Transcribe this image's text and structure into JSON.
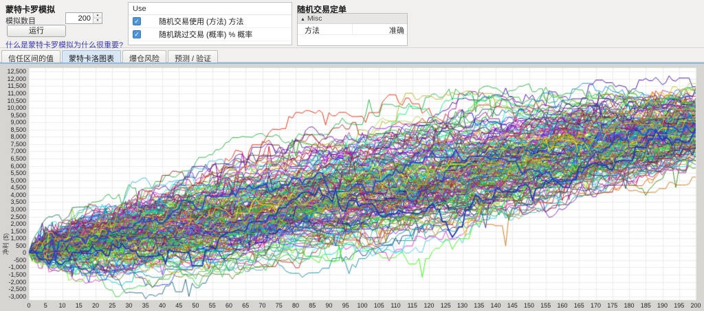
{
  "header": {
    "title": "蒙特卡罗模拟",
    "sim_count_label": "模拟数目",
    "sim_count_value": "200",
    "run_button": "运行",
    "help_link": "什么是蒙特卡罗模拟为什么很重要?"
  },
  "use_panel": {
    "header": "Use",
    "options": [
      {
        "label": "随机交易使用 (方法) 方法",
        "checked": true
      },
      {
        "label": "随机跳过交易 (概率) % 概率",
        "checked": true
      }
    ]
  },
  "orders_panel": {
    "title": "随机交易定单",
    "group": "Misc",
    "rows": [
      {
        "name": "方法",
        "value": "准确"
      }
    ]
  },
  "tabs": [
    {
      "label": "信任区间的值",
      "active": false
    },
    {
      "label": "蒙特卡洛图表",
      "active": true
    },
    {
      "label": "爆仓风险",
      "active": false
    },
    {
      "label": "预测 / 验证",
      "active": false
    }
  ],
  "chart_data": {
    "type": "line",
    "title": "",
    "xlabel": "",
    "ylabel": "净利 ($)",
    "xlim": [
      0,
      200
    ],
    "ylim": [
      -3250,
      12750
    ],
    "x_ticks": [
      0,
      5,
      10,
      15,
      20,
      25,
      30,
      35,
      40,
      45,
      50,
      55,
      60,
      65,
      70,
      75,
      80,
      85,
      90,
      95,
      100,
      105,
      110,
      115,
      120,
      125,
      130,
      135,
      140,
      145,
      150,
      155,
      160,
      165,
      170,
      175,
      180,
      185,
      190,
      195,
      200
    ],
    "y_ticks": [
      -3000,
      -2500,
      -2000,
      -1500,
      -1000,
      -500,
      0,
      500,
      1000,
      1500,
      2000,
      2500,
      3000,
      3500,
      4000,
      4500,
      5000,
      5500,
      6000,
      6500,
      7000,
      7500,
      8000,
      8500,
      9000,
      9500,
      10000,
      10500,
      11000,
      11500,
      12000,
      12500
    ],
    "grid": true,
    "legend": "none",
    "series_count": 200,
    "description": "Monte Carlo equity-curve fan: 200 simulated cumulative-profit paths starting at 0 and drifting to roughly 6500–11500 by trade 200, with transient spikes and occasional deep drawdowns to about -2500.",
    "simulation": {
      "steps": 200,
      "start_value": 0,
      "mean_final": 8700,
      "final_sd": 1300,
      "bridge_step_sd": 255,
      "flat_step_prob": 0.3,
      "spike_prob": 0.013,
      "seed": 20240207
    },
    "highlight_series": [
      {
        "color": "#1f3bb3",
        "final": 8600,
        "dip_center": 127,
        "dip_depth": 2800,
        "dip_halfwidth": 7,
        "width": 1.8
      },
      {
        "color": "#2a46c8",
        "final": 8300,
        "dip_center": 163,
        "dip_depth": 2300,
        "dip_halfwidth": 24,
        "width": 1.8
      }
    ],
    "colors_bg": {
      "plot": "#ffffff",
      "margin": "#d6d5d2",
      "grid": "#ebebeb"
    }
  }
}
